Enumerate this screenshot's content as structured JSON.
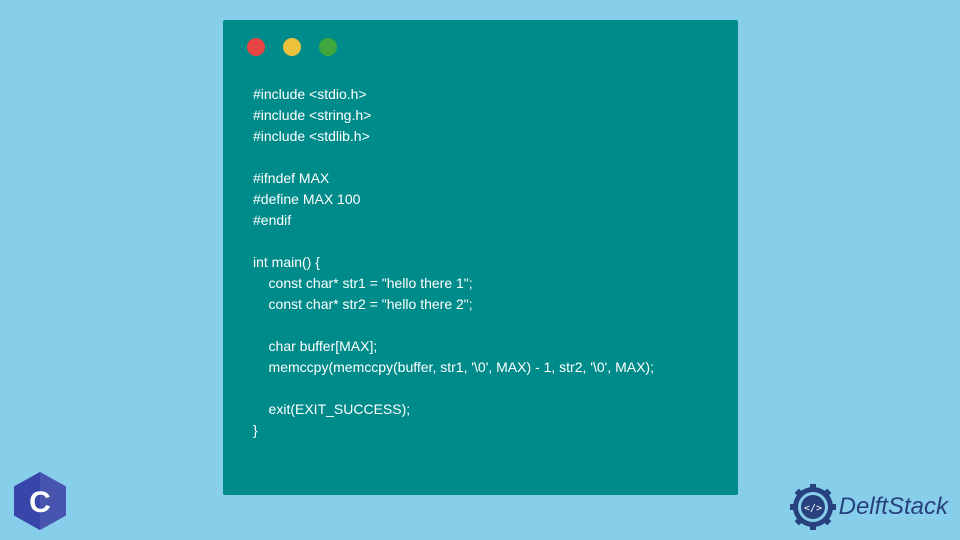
{
  "code": {
    "lines": "#include <stdio.h>\n#include <string.h>\n#include <stdlib.h>\n\n#ifndef MAX\n#define MAX 100\n#endif\n\nint main() {\n    const char* str1 = \"hello there 1\";\n    const char* str2 = \"hello there 2\";\n\n    char buffer[MAX];\n    memccpy(memccpy(buffer, str1, '\\0', MAX) - 1, str2, '\\0', MAX);\n\n    exit(EXIT_SUCCESS);\n}"
  },
  "brand": {
    "name": "DelftStack"
  }
}
